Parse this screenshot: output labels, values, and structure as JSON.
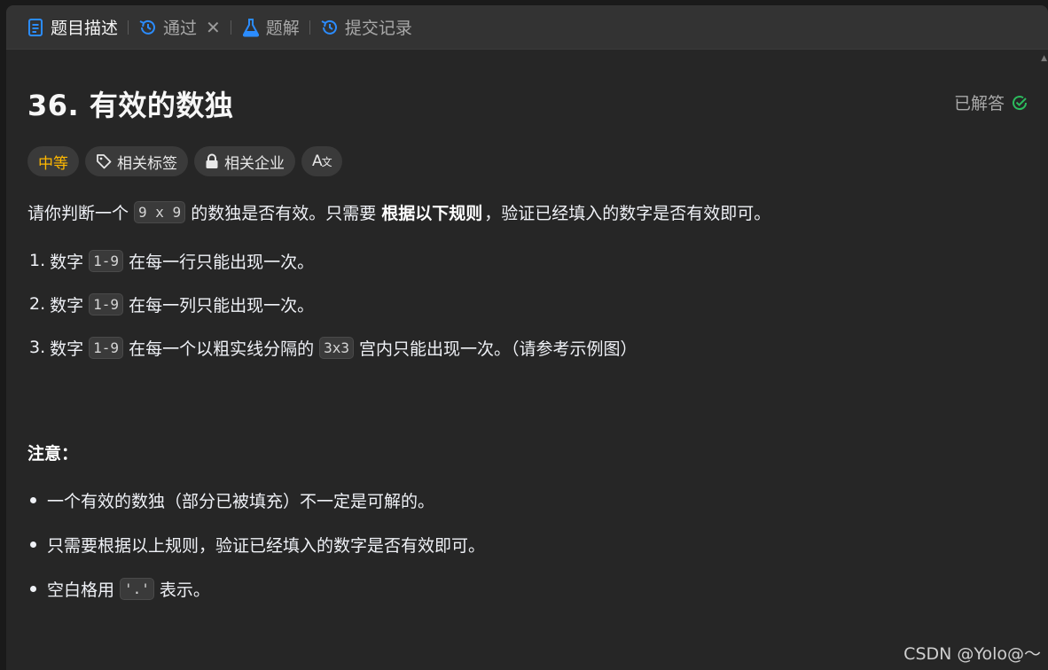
{
  "tabs": [
    {
      "label": "题目描述",
      "icon": "document-icon",
      "active": true
    },
    {
      "label": "通过",
      "icon": "history-icon",
      "closable": true
    },
    {
      "label": "题解",
      "icon": "flask-icon"
    },
    {
      "label": "提交记录",
      "icon": "history-icon"
    }
  ],
  "problem": {
    "title": "36. 有效的数独",
    "status": "已解答",
    "tags": {
      "difficulty": "中等",
      "related_tags": "相关标签",
      "related_companies": "相关企业",
      "translate": "A文"
    }
  },
  "description": {
    "intro_pre": "请你判断一个",
    "intro_code": "9 x 9",
    "intro_mid": "的数独是否有效。只需要",
    "intro_bold": "根据以下规则",
    "intro_post": "，验证已经填入的数字是否有效即可。",
    "rules": [
      {
        "num": "1.",
        "pre": "数字",
        "code": "1-9",
        "post": "在每一行只能出现一次。"
      },
      {
        "num": "2.",
        "pre": "数字",
        "code": "1-9",
        "post": "在每一列只能出现一次。"
      },
      {
        "num": "3.",
        "pre": "数字",
        "code": "1-9",
        "mid": "在每一个以粗实线分隔的",
        "code2": "3x3",
        "post": "宫内只能出现一次。（请参考示例图）"
      }
    ],
    "notes_heading": "注意：",
    "notes": [
      {
        "text": "一个有效的数独（部分已被填充）不一定是可解的。"
      },
      {
        "text": "只需要根据以上规则，验证已经填入的数字是否有效即可。"
      },
      {
        "pre": "空白格用",
        "code": "'.'",
        "post": "表示。"
      }
    ]
  },
  "watermark": "CSDN @Yolo@～",
  "colors": {
    "background": "#262626",
    "tabbar": "#333333",
    "difficulty_medium": "#ffb800",
    "solved_check": "#2cbb5d",
    "tab_icon_blue": "#007aff"
  }
}
